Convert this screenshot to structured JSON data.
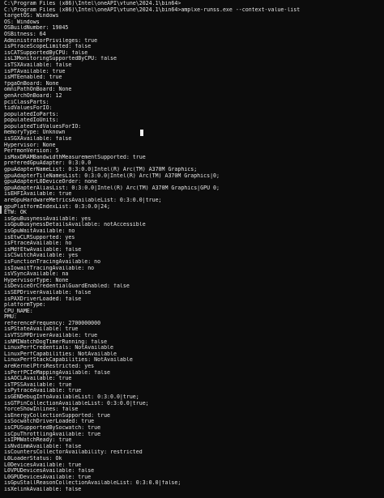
{
  "console": {
    "lines": [
      "C:\\Program Files (x86)\\Intel\\oneAPI\\vtune\\2024.1\\bin64>",
      "C:\\Program Files (x86)\\Intel\\oneAPI\\vtune\\2024.1\\bin64>amplxe-runss.exe --context-value-list",
      "targetOS: Windows",
      "OS: Windows",
      "OSBuildNumber: 19045",
      "OSBitness: 64",
      "AdministratorPrivileges: true",
      "isPtraceScopeLimited: false",
      "isCATSupportedByCPU: false",
      "isL3MonitoringSupportedByCPU: false",
      "isTSXAvailable: false",
      "isPTAvailable: true",
      "isMTEenabled: true",
      "fpgaOnBoard: None",
      "omniPathOnBoard: None",
      "genArchOnBoard: 12",
      "pciClassParts:",
      "tidValuesForIO:",
      "populatedIoParts:",
      "populatedIoUnits:",
      "populatedTidValuesForIO:",
      "memoryType: Unknown",
      "isSGXAvailable: false",
      "Hypervisor: None",
      "PerfmonVersion: 5",
      "isMaxDRAMBandwidthMeasurementSupported: true",
      "preferedGpuAdapter: 0:3:0.0",
      "gpuAdapterNameList: 0:3:0.0|Intel(R) Arc(TM) A370M Graphics;",
      "gpuAdapterTileNamesList: 0:3:0.0|Intel(R) Arc(TM) A370M Graphics|0;",
      "gpuAdapterL0DeviceOrder: none",
      "gpuAdapterAliasList: 0:3:0.0|Intel(R) Arc(TM) A370M Graphics|GPU 0;",
      "isEHFIAvailable: true",
      "areGpuHardwareMetricsAvailableList: 0:3:0.0|true;",
      "gpuPlatformIndexList: 0:3:0.0|24;",
      "ETW: OK",
      "isGpuBusynessAvailable: yes",
      "isGpuBusynessDetailsAvailable: notAccessible",
      "isGpuWaitAvailable: no",
      "isEtwCLRSupported: yes",
      "isFtraceAvailable: no",
      "isMdfEtwAvailable: false",
      "isCSwitchAvailable: yes",
      "isFunctionTracingAvailable: no",
      "isIowaitTracingAvailable: no",
      "isVSyncAvailable: na",
      "HypervisorType: None",
      "isDeviceOrCredentialGuardEnabled: false",
      "isSEPDriverAvailable: false",
      "isPAXDriverLoaded: false",
      "platformType:",
      "CPU_NAME:",
      "PMU:",
      "referenceFrequency: 2700000000",
      "isPStateAvailable: true",
      "isVTSSPPDriverAvailable: true",
      "isNMIWatchDogTimerRunning: false",
      "LinuxPerfCredentials: NotAvailable",
      "LinuxPerfCapabilities: NotAvailable",
      "LinuxPerfStackCapabilities: NotAvailable",
      "areKernelPtrsRestricted: yes",
      "isPerfPCIeMappingAvailable: false",
      "isAOCLAvailable: true",
      "isTPSSAvailable: true",
      "isPytraceAvailable: true",
      "isGENDebugInfoAvailableList: 0:3:0.0|true;",
      "isGTPinCollectionAvailableList: 0:3:0.0|true;",
      "forceShowInlines: false",
      "isEnergyCollectionSupported: true",
      "isSocwatchDriverLoaded: true",
      "isCPUSupportedBySocwatch: true",
      "isCpuThrottlingAvailable: true",
      "isIPMWatchReady: true",
      "isNvdimmAvailable: false",
      "isCountersCollectorAvailability: restricted",
      "L0LoaderStatus: Ok",
      "L0DevicesAvailable: true",
      "L0VPUDevicesAvailable: false",
      "L0GPUDevicesAvailable: true",
      "isGpuStallReasonCollectionAvailableList: 0:3:0.0|false;",
      "isXelinkAvailable: false"
    ]
  }
}
